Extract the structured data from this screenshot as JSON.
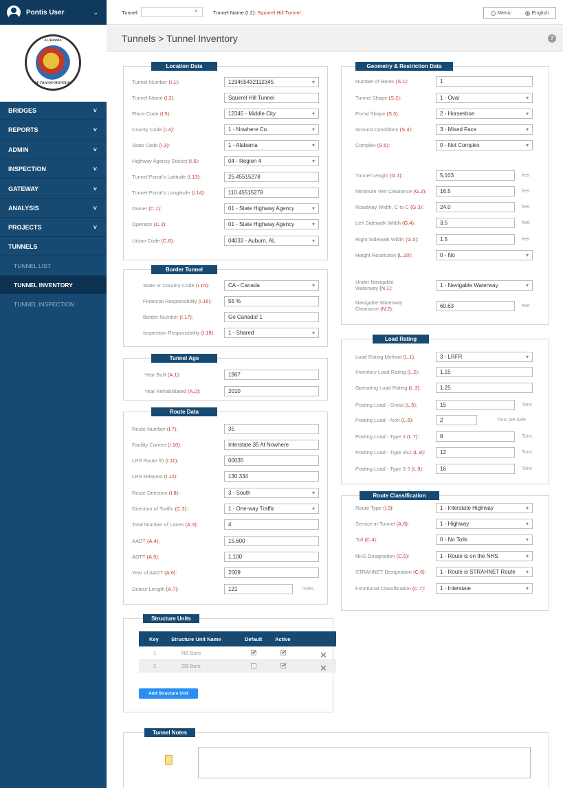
{
  "user": {
    "name": "Pontis User"
  },
  "logo": {
    "top_text": "ALABAMA",
    "bottom_text": "OF TRANSPORTATION",
    "left_text": "DEPARTMENT"
  },
  "menu": [
    {
      "label": "BRIDGES"
    },
    {
      "label": "REPORTS"
    },
    {
      "label": "ADMIN"
    },
    {
      "label": "INSPECTION"
    },
    {
      "label": "GATEWAY"
    },
    {
      "label": "ANALYSIS"
    },
    {
      "label": "PROJECTS"
    },
    {
      "label": "TUNNELS"
    }
  ],
  "submenu": [
    {
      "label": "TUNNEL LIST"
    },
    {
      "label": "TUNNEL INVENTORY"
    },
    {
      "label": "TUNNEL INSPECTION"
    }
  ],
  "topbar": {
    "tunnel_label": "Tunnel:",
    "tunnel_name_label": "Tunnel Name (I.2):",
    "tunnel_name_value": "Squirrel Hill Tunnel",
    "metric": "Metric",
    "english": "English"
  },
  "page_title": "Tunnels > Tunnel Inventory",
  "help": "?",
  "location": {
    "title": "Location Data",
    "fields": [
      {
        "label": "Tunnel Number",
        "code": "(I.1):",
        "value": "123455432112345"
      },
      {
        "label": "Tunnel Name",
        "code": "(I.2):",
        "value": "Squirrel Hill Tunnel"
      },
      {
        "label": "Place Code",
        "code": "(I.5):",
        "value": "12345 - Middle City"
      },
      {
        "label": "County Code",
        "code": "(I.4):",
        "value": "1 - Nowhere Co."
      },
      {
        "label": "State Code",
        "code": "(I.3):",
        "value": "1 - Alabama"
      },
      {
        "label": "Highway Agency District",
        "code": "(I.6):",
        "value": "04 - Region 4"
      },
      {
        "label": "Tunnel Portal's Latitude",
        "code": "(I.13):",
        "value": "25.45515278"
      },
      {
        "label": "Tunnel Portal's Longitude",
        "code": "(I.14):",
        "value": "110.45515278"
      },
      {
        "label": "Owner",
        "code": "(C.1):",
        "value": "01 - State Highway Agency"
      },
      {
        "label": "Operator",
        "code": "(C.2):",
        "value": "01 - State Highway Agency"
      },
      {
        "label": "Urban Code",
        "code": "(C.8):",
        "value": "04033 - Auburn, AL"
      }
    ]
  },
  "border": {
    "title": "Border Tunnel",
    "fields": [
      {
        "label": "State or Country Code",
        "code": "(I.15):",
        "value": "CA - Canada"
      },
      {
        "label": "Financial Responsibility",
        "code": "(I.16):",
        "value": "55 %"
      },
      {
        "label": "Border Number",
        "code": "(I.17):",
        "value": "Go Canada! 1"
      },
      {
        "label": "Inspection Responsibility",
        "code": "(I.18):",
        "value": "1 - Shared"
      }
    ]
  },
  "age": {
    "title": "Tunnel Age",
    "fields": [
      {
        "label": "Year Built",
        "code": "(A.1):",
        "value": "1967"
      },
      {
        "label": "Year Rehabilitated",
        "code": "(A.2):",
        "value": "2010"
      }
    ]
  },
  "route": {
    "title": "Route Data",
    "fields": [
      {
        "label": "Route Number",
        "code": "(I.7):",
        "value": "35"
      },
      {
        "label": "Facility Carried",
        "code": "(I.10):",
        "value": "Interstate 35 At Nowhere"
      },
      {
        "label": "LRS Route ID",
        "code": "(I.11):",
        "value": "00035"
      },
      {
        "label": "LRS Milepost",
        "code": "(I.12):",
        "value": "130.334"
      },
      {
        "label": "Route Direction",
        "code": "(I.8):",
        "value": "3 - South"
      },
      {
        "label": "Direction of Traffic",
        "code": "(C.3):",
        "value": "1 - One-way Traffic"
      },
      {
        "label": "Total Number of Lanes",
        "code": "(A.3):",
        "value": "4"
      },
      {
        "label": "AADT",
        "code": "(A.4):",
        "value": "15,600"
      },
      {
        "label": "ADTT",
        "code": "(A.5):",
        "value": "1,100"
      },
      {
        "label": "Year of AADT",
        "code": "(A.6):",
        "value": "2009"
      },
      {
        "label": "Detour Length",
        "code": "(A.7):",
        "value": "121",
        "unit": "miles"
      }
    ]
  },
  "geometry": {
    "title": "Geometry & Restriction Data",
    "fields": [
      {
        "label": "Number of Bores",
        "code": "(S.1):",
        "value": "1"
      },
      {
        "label": "Tunnel Shape",
        "code": "(S.2):",
        "value": "1 - Oval"
      },
      {
        "label": "Portal Shape",
        "code": "(S.3):",
        "value": "2 - Horseshoe"
      },
      {
        "label": "Ground Conditions",
        "code": "(S.4):",
        "value": "3 - Mixed Face"
      },
      {
        "label": "Complex",
        "code": "(S.5):",
        "value": "0 - Not Complex"
      },
      {
        "label": "Tunnel Length",
        "code": "(G.1):",
        "value": "5,103",
        "unit": "feet"
      },
      {
        "label": "Minimum Vert Clearance",
        "code": "(G.2):",
        "value": "16.5",
        "unit": "feet"
      },
      {
        "label": "Roadway Width, C to C",
        "code": "(G.3):",
        "value": "24.0",
        "unit": "feet"
      },
      {
        "label": "Left Sidewalk Width",
        "code": "(G.4):",
        "value": "3.5",
        "unit": "feet"
      },
      {
        "label": "Right Sidewalk Width",
        "code": "(G.5):",
        "value": "1.5",
        "unit": "feet"
      },
      {
        "label": "Height Restriction",
        "code": "(L.10):",
        "value": "0 - No"
      },
      {
        "label": "Under Navigable",
        "label2": "Waterway",
        "code": "(N.1):",
        "value": "1 - Navigable Waterway"
      },
      {
        "label": "Navigable Waterway",
        "label2": "Clearance",
        "code": "(N.2):",
        "value": "60.63",
        "unit": "feet"
      }
    ]
  },
  "load": {
    "title": "Load Rating",
    "fields": [
      {
        "label": "Load Rating Method",
        "code": "(L.1):",
        "value": "3 - LRFR"
      },
      {
        "label": "Inventory Load Rating",
        "code": "(L.2):",
        "value": "1.15"
      },
      {
        "label": "Operating Load Rating",
        "code": "(L.3):",
        "value": "1.25"
      },
      {
        "label": "Posting Load - Gross",
        "code": "(L.5):",
        "value": "15",
        "unit": "Tons"
      },
      {
        "label": "Posting Load - Axel",
        "code": "(L.6):",
        "value": "2",
        "unit": "Tons per Axle"
      },
      {
        "label": "Posting Load - Type 3",
        "code": "(L.7):",
        "value": "8",
        "unit": "Tons"
      },
      {
        "label": "Posting Load - Type 3S2",
        "code": "(L.8):",
        "value": "12",
        "unit": "Tons"
      },
      {
        "label": "Posting Load - Type 3-3",
        "code": "(L.9):",
        "value": "16",
        "unit": "Tons"
      }
    ]
  },
  "classification": {
    "title": "Route Classification",
    "fields": [
      {
        "label": "Route Type",
        "code": "(I.9):",
        "value": "1 - Interstate Highway"
      },
      {
        "label": "Service in Tunnel",
        "code": "(A.8):",
        "value": "1 - Highway"
      },
      {
        "label": "Toll",
        "code": "(C.4):",
        "value": "0 - No Tolls"
      },
      {
        "label": "NHS Designation",
        "code": "(C.5):",
        "value": "1 - Route is on the NHS"
      },
      {
        "label": "STRAHNET Designation",
        "code": "(C.6):",
        "value": "1 - Route is STRAHNET Route"
      },
      {
        "label": "Functional Classification",
        "code": "(C.7):",
        "value": "1 - Interstate"
      }
    ]
  },
  "structure_units": {
    "title": "Structure Units",
    "headers": [
      "Key",
      "Structure Unit Name",
      "Default",
      "Active"
    ],
    "rows": [
      {
        "key": "1",
        "name": "NB Bore",
        "default": true,
        "active": true
      },
      {
        "key": "2",
        "name": "SB Bore",
        "default": false,
        "active": true
      }
    ],
    "add_label": "Add Structure Unit"
  },
  "notes": {
    "title": "Tunnel Notes"
  }
}
